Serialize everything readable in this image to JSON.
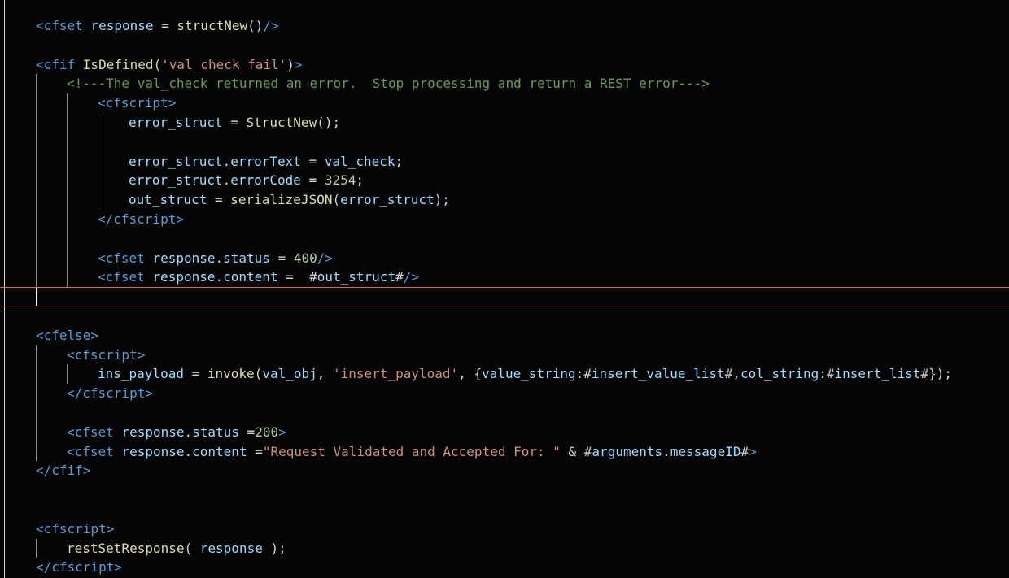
{
  "editor": {
    "lines": [
      {
        "indent": 0,
        "tokens": [
          {
            "t": "tag",
            "v": "<cfset "
          },
          {
            "t": "attr",
            "v": "response"
          },
          {
            "t": "plain",
            "v": " = "
          },
          {
            "t": "fn",
            "v": "structNew"
          },
          {
            "t": "plain",
            "v": "()"
          },
          {
            "t": "tag",
            "v": "/>"
          }
        ]
      },
      {
        "indent": 0,
        "tokens": []
      },
      {
        "indent": 0,
        "tokens": [
          {
            "t": "tag",
            "v": "<cfif "
          },
          {
            "t": "fn",
            "v": "IsDefined"
          },
          {
            "t": "plain",
            "v": "("
          },
          {
            "t": "string",
            "v": "'val_check_fail'"
          },
          {
            "t": "plain",
            "v": ")"
          },
          {
            "t": "tag",
            "v": ">"
          }
        ]
      },
      {
        "indent": 1,
        "tokens": [
          {
            "t": "comment",
            "v": "<!---The val_check returned an error.  Stop processing and return a REST error--->"
          }
        ]
      },
      {
        "indent": 2,
        "tokens": [
          {
            "t": "tag",
            "v": "<cfscript>"
          }
        ]
      },
      {
        "indent": 3,
        "tokens": [
          {
            "t": "attr",
            "v": "error_struct"
          },
          {
            "t": "plain",
            "v": " = "
          },
          {
            "t": "fn",
            "v": "StructNew"
          },
          {
            "t": "plain",
            "v": "();"
          }
        ]
      },
      {
        "indent": 3,
        "tokens": []
      },
      {
        "indent": 3,
        "tokens": [
          {
            "t": "attr",
            "v": "error_struct"
          },
          {
            "t": "plain",
            "v": "."
          },
          {
            "t": "attr",
            "v": "errorText"
          },
          {
            "t": "plain",
            "v": " = "
          },
          {
            "t": "attr",
            "v": "val_check"
          },
          {
            "t": "plain",
            "v": ";"
          }
        ]
      },
      {
        "indent": 3,
        "tokens": [
          {
            "t": "attr",
            "v": "error_struct"
          },
          {
            "t": "plain",
            "v": "."
          },
          {
            "t": "attr",
            "v": "errorCode"
          },
          {
            "t": "plain",
            "v": " = "
          },
          {
            "t": "num",
            "v": "3254"
          },
          {
            "t": "plain",
            "v": ";"
          }
        ]
      },
      {
        "indent": 3,
        "tokens": [
          {
            "t": "attr",
            "v": "out_struct"
          },
          {
            "t": "plain",
            "v": " = "
          },
          {
            "t": "fn",
            "v": "serializeJSON"
          },
          {
            "t": "plain",
            "v": "("
          },
          {
            "t": "attr",
            "v": "error_struct"
          },
          {
            "t": "plain",
            "v": ");"
          }
        ]
      },
      {
        "indent": 2,
        "tokens": [
          {
            "t": "tag",
            "v": "</cfscript>"
          }
        ]
      },
      {
        "indent": 2,
        "tokens": []
      },
      {
        "indent": 2,
        "tokens": [
          {
            "t": "tag",
            "v": "<cfset "
          },
          {
            "t": "attr",
            "v": "response"
          },
          {
            "t": "plain",
            "v": "."
          },
          {
            "t": "attr",
            "v": "status"
          },
          {
            "t": "plain",
            "v": " = "
          },
          {
            "t": "num",
            "v": "400"
          },
          {
            "t": "tag",
            "v": "/>"
          }
        ]
      },
      {
        "indent": 2,
        "tokens": [
          {
            "t": "tag",
            "v": "<cfset "
          },
          {
            "t": "attr",
            "v": "response"
          },
          {
            "t": "plain",
            "v": "."
          },
          {
            "t": "attr",
            "v": "content"
          },
          {
            "t": "plain",
            "v": " =  #"
          },
          {
            "t": "attr",
            "v": "out_struct"
          },
          {
            "t": "plain",
            "v": "#"
          },
          {
            "t": "tag",
            "v": "/>"
          }
        ]
      },
      {
        "indent": 0,
        "tokens": [],
        "current": true
      },
      {
        "indent": 0,
        "tokens": []
      },
      {
        "indent": 0,
        "tokens": [
          {
            "t": "tag",
            "v": "<cfelse>"
          }
        ]
      },
      {
        "indent": 1,
        "tokens": [
          {
            "t": "tag",
            "v": "<cfscript>"
          }
        ]
      },
      {
        "indent": 2,
        "tokens": [
          {
            "t": "attr",
            "v": "ins_payload"
          },
          {
            "t": "plain",
            "v": " = "
          },
          {
            "t": "fn",
            "v": "invoke"
          },
          {
            "t": "plain",
            "v": "("
          },
          {
            "t": "attr",
            "v": "val_obj"
          },
          {
            "t": "plain",
            "v": ", "
          },
          {
            "t": "string",
            "v": "'insert_payload'"
          },
          {
            "t": "plain",
            "v": ", {"
          },
          {
            "t": "attr",
            "v": "value_string"
          },
          {
            "t": "plain",
            "v": ":#"
          },
          {
            "t": "attr",
            "v": "insert_value_list"
          },
          {
            "t": "plain",
            "v": "#,"
          },
          {
            "t": "attr",
            "v": "col_string"
          },
          {
            "t": "plain",
            "v": ":#"
          },
          {
            "t": "attr",
            "v": "insert_list"
          },
          {
            "t": "plain",
            "v": "#});"
          }
        ]
      },
      {
        "indent": 1,
        "tokens": [
          {
            "t": "tag",
            "v": "</cfscript>"
          }
        ]
      },
      {
        "indent": 1,
        "tokens": []
      },
      {
        "indent": 1,
        "tokens": [
          {
            "t": "tag",
            "v": "<cfset "
          },
          {
            "t": "attr",
            "v": "response"
          },
          {
            "t": "plain",
            "v": "."
          },
          {
            "t": "attr",
            "v": "status"
          },
          {
            "t": "plain",
            "v": " ="
          },
          {
            "t": "num",
            "v": "200"
          },
          {
            "t": "tag",
            "v": ">"
          }
        ]
      },
      {
        "indent": 1,
        "tokens": [
          {
            "t": "tag",
            "v": "<cfset "
          },
          {
            "t": "attr",
            "v": "response"
          },
          {
            "t": "plain",
            "v": "."
          },
          {
            "t": "attr",
            "v": "content"
          },
          {
            "t": "plain",
            "v": " ="
          },
          {
            "t": "string",
            "v": "\"Request Validated and Accepted For: \""
          },
          {
            "t": "plain",
            "v": " & #"
          },
          {
            "t": "attr",
            "v": "arguments"
          },
          {
            "t": "plain",
            "v": "."
          },
          {
            "t": "attr",
            "v": "messageID"
          },
          {
            "t": "plain",
            "v": "#"
          },
          {
            "t": "tag",
            "v": ">"
          }
        ]
      },
      {
        "indent": 0,
        "tokens": [
          {
            "t": "tag",
            "v": "</cfif>"
          }
        ]
      },
      {
        "indent": 0,
        "tokens": []
      },
      {
        "indent": 0,
        "tokens": []
      },
      {
        "indent": 0,
        "tokens": [
          {
            "t": "tag",
            "v": "<cfscript>"
          }
        ]
      },
      {
        "indent": 1,
        "tokens": [
          {
            "t": "fn",
            "v": "restSetResponse"
          },
          {
            "t": "plain",
            "v": "( "
          },
          {
            "t": "attr",
            "v": "response"
          },
          {
            "t": "plain",
            "v": " );"
          }
        ]
      },
      {
        "indent": 0,
        "tokens": [
          {
            "t": "tag",
            "v": "</cfscript>"
          }
        ]
      }
    ]
  }
}
